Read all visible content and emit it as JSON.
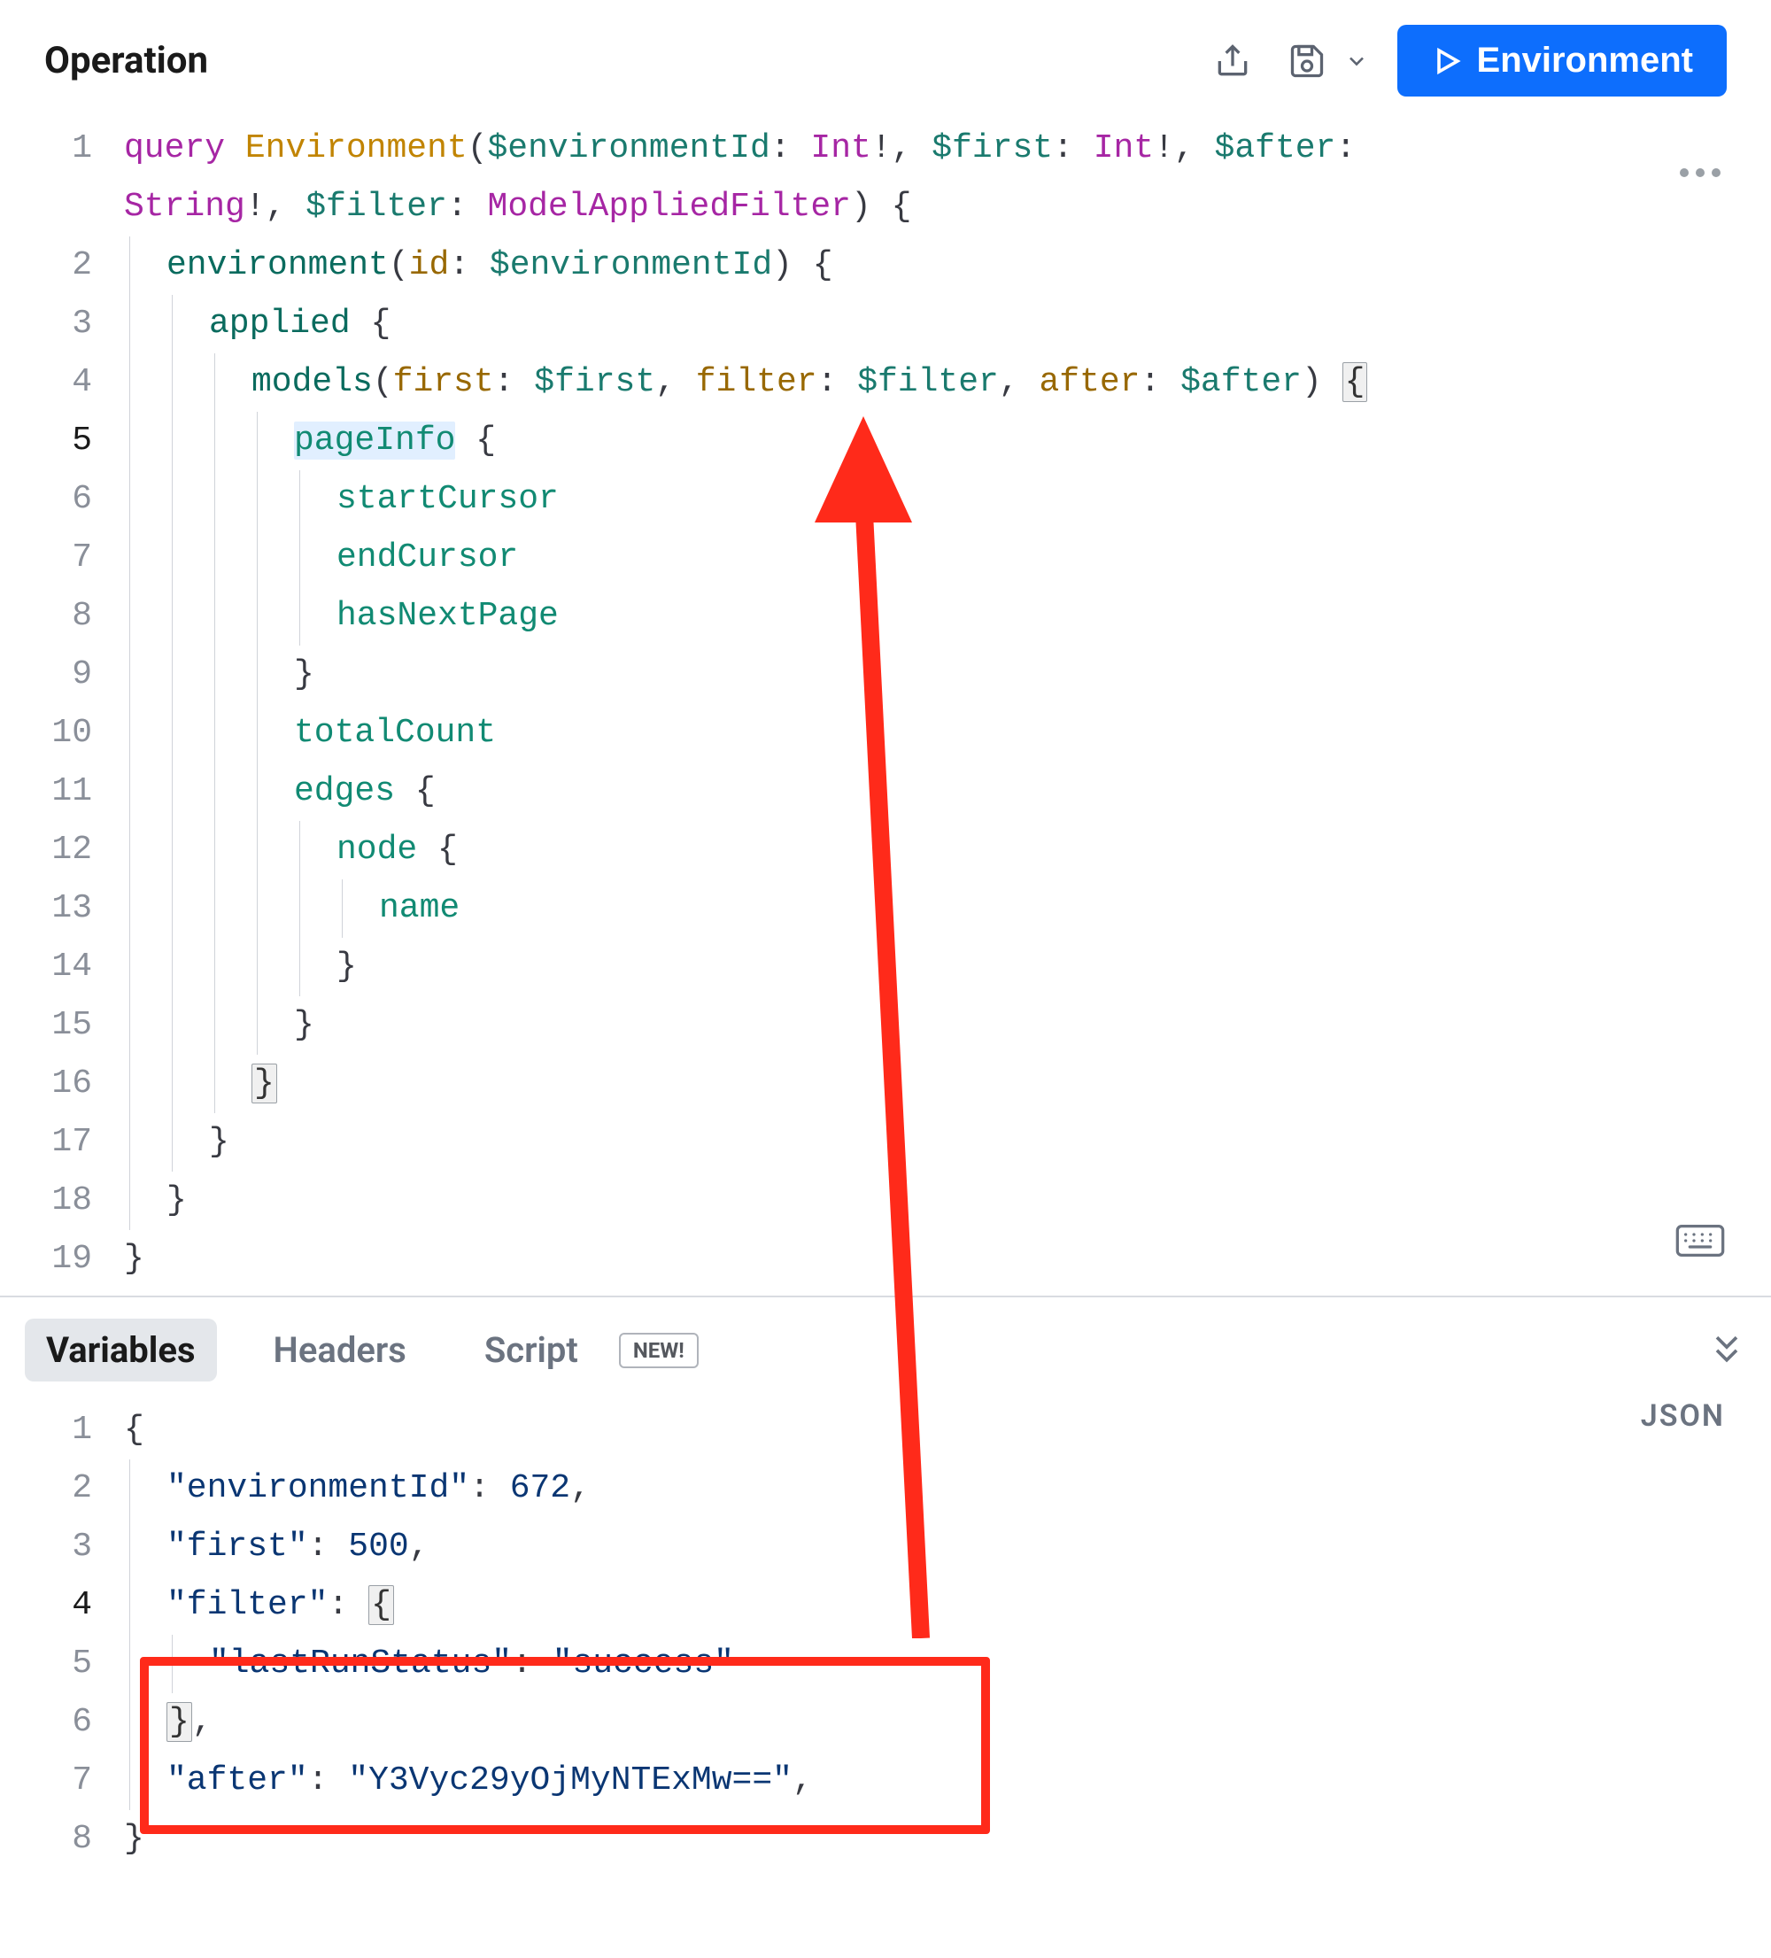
{
  "header": {
    "title": "Operation",
    "run_label": "Environment"
  },
  "operation": {
    "lines": [
      {
        "n": 1,
        "html": "<span class='kw'>query</span> <span class='fn'>Environment</span><span class='punc'>(</span><span class='var-g'>$environmentId</span><span class='punc'>:</span> <span class='type'>Int</span><span class='punc'>!,</span> <span class='var-g'>$first</span><span class='punc'>:</span> <span class='type'>Int</span><span class='punc'>!,</span> <span class='var-g'>$after</span><span class='punc'>:</span> "
      },
      {
        "n": "",
        "continuation": true,
        "html": "<span class='type'>String</span><span class='punc'>!,</span> <span class='var-g'>$filter</span><span class='punc'>:</span> <span class='type'>ModelAppliedFilter</span><span class='punc'>)</span> <span class='punc'>{</span>"
      },
      {
        "n": 2,
        "indent": 1,
        "html": "<span class='nm'>environment</span><span class='punc'>(</span><span class='arg'>id</span><span class='punc'>:</span> <span class='var-g'>$environmentId</span><span class='punc'>)</span> <span class='punc'>{</span>"
      },
      {
        "n": 3,
        "indent": 2,
        "html": "<span class='nm'>applied</span> <span class='punc'>{</span>"
      },
      {
        "n": 4,
        "indent": 3,
        "html": "<span class='nm'>models</span><span class='punc'>(</span><span class='arg'>first</span><span class='punc'>:</span> <span class='var-g'>$first</span><span class='punc'>,</span> <span class='arg'>filter</span><span class='punc'>:</span> <span class='var-g'>$filter</span><span class='punc'>,</span> <span class='arg'>after</span><span class='punc'>:</span> <span class='var-g'>$after</span><span class='punc'>)</span> <span class='brace-hl'>{</span>"
      },
      {
        "n": 5,
        "indent": 4,
        "html": "<span class='field highlight'>pageInfo</span> <span class='punc'>{</span>",
        "active": true
      },
      {
        "n": 6,
        "indent": 5,
        "html": "<span class='field'>startCursor</span>"
      },
      {
        "n": 7,
        "indent": 5,
        "html": "<span class='field'>endCursor</span>"
      },
      {
        "n": 8,
        "indent": 5,
        "html": "<span class='field'>hasNextPage</span>"
      },
      {
        "n": 9,
        "indent": 4,
        "html": "<span class='punc'>}</span>"
      },
      {
        "n": 10,
        "indent": 4,
        "html": "<span class='field'>totalCount</span>"
      },
      {
        "n": 11,
        "indent": 4,
        "html": "<span class='field'>edges</span> <span class='punc'>{</span>"
      },
      {
        "n": 12,
        "indent": 5,
        "html": "<span class='field'>node</span> <span class='punc'>{</span>"
      },
      {
        "n": 13,
        "indent": 6,
        "html": "<span class='field'>name</span>"
      },
      {
        "n": 14,
        "indent": 5,
        "html": "<span class='punc'>}</span>"
      },
      {
        "n": 15,
        "indent": 4,
        "html": "<span class='punc'>}</span>"
      },
      {
        "n": 16,
        "indent": 3,
        "html": "<span class='brace-hl'>}</span>"
      },
      {
        "n": 17,
        "indent": 2,
        "html": "<span class='punc'>}</span>"
      },
      {
        "n": 18,
        "indent": 1,
        "html": "<span class='punc'>}</span>"
      },
      {
        "n": 19,
        "indent": 0,
        "html": "<span class='punc'>}</span>"
      }
    ]
  },
  "panel": {
    "tabs": [
      {
        "label": "Variables",
        "active": true
      },
      {
        "label": "Headers"
      },
      {
        "label": "Script"
      }
    ],
    "new_badge": "NEW!",
    "format_label": "JSON"
  },
  "variables": {
    "lines": [
      {
        "n": 1,
        "indent": 0,
        "html": "<span class='punc'>{</span>"
      },
      {
        "n": 2,
        "indent": 1,
        "html": "<span class='str'>\"environmentId\"</span><span class='punc'>:</span> <span class='num'>672</span><span class='punc'>,</span>"
      },
      {
        "n": 3,
        "indent": 1,
        "html": "<span class='str'>\"first\"</span><span class='punc'>:</span> <span class='num'>500</span><span class='punc'>,</span>"
      },
      {
        "n": 4,
        "indent": 1,
        "html": "<span class='str'>\"filter\"</span><span class='punc'>:</span> <span class='brace-hl'>{</span>",
        "active": true
      },
      {
        "n": 5,
        "indent": 2,
        "html": "<span class='str'>\"lastRunStatus\"</span><span class='punc'>:</span> <span class='str'>\"success\"</span>"
      },
      {
        "n": 6,
        "indent": 1,
        "html": "<span class='brace-hl'>}</span><span class='punc'>,</span>"
      },
      {
        "n": 7,
        "indent": 1,
        "html": "<span class='str'>\"after\"</span><span class='punc'>:</span> <span class='str'>\"Y3Vyc29yOjMyNTExMw==\"</span><span class='punc'>,</span>"
      },
      {
        "n": 8,
        "indent": 0,
        "html": "<span class='punc'>}</span>"
      }
    ]
  },
  "colors": {
    "primary": "#0d6efd",
    "annotation": "#ff2a1a"
  }
}
